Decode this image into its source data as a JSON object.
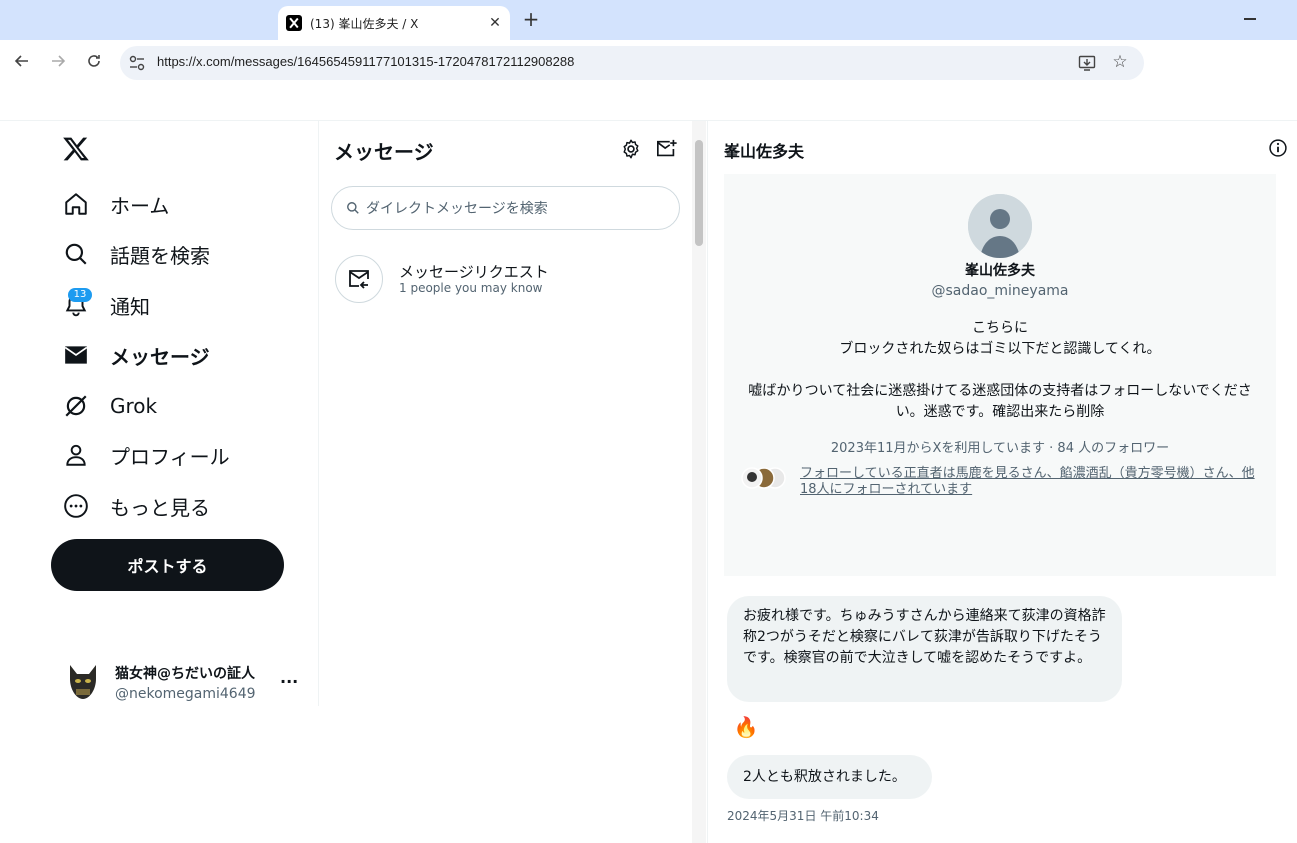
{
  "browser": {
    "tab_title": "(13) 峯山佐多夫 / X",
    "tab_close": "✕",
    "new_tab": "+",
    "url": "https://x.com/messages/1645654591177101315-1720478172112908288"
  },
  "nav": {
    "items": [
      {
        "label": "ホーム",
        "icon": "home-icon"
      },
      {
        "label": "話題を検索",
        "icon": "search-icon"
      },
      {
        "label": "通知",
        "icon": "bell-icon"
      },
      {
        "label": "メッセージ",
        "icon": "envelope-icon"
      },
      {
        "label": "Grok",
        "icon": "grok-icon"
      },
      {
        "label": "プロフィール",
        "icon": "person-icon"
      },
      {
        "label": "もっと見る",
        "icon": "more-circle-icon"
      }
    ],
    "notification_count": "13",
    "post_button": "ポストする"
  },
  "account": {
    "name": "猫女神@ちだいの証人",
    "handle": "@nekomegami4649",
    "more": "···"
  },
  "messages": {
    "heading": "メッセージ",
    "search_placeholder": "ダイレクトメッセージを検索",
    "request_title": "メッセージリクエスト",
    "request_sub": "1 people you may know"
  },
  "conversation": {
    "title": "峯山佐多夫",
    "profile": {
      "name": "峯山佐多夫",
      "handle": "@sadao_mineyama",
      "bio": "こちらに\nブロックされた奴らはゴミ以下だと認識してくれ。\n\n嘘ばかりついて社会に迷惑掛けてる迷惑団体の支持者はフォローしないでください。迷惑です。確認出来たら削除",
      "meta": "2023年11月からXを利用しています · 84 人のフォロワー",
      "followed_by": "フォローしている正直者は馬鹿を見るさん、餡濃酒乱（貴方零号機）さん、他18人にフォローされています"
    },
    "messages": [
      {
        "text": "お疲れ様です。ちゅみうすさんから連絡来て荻津の資格詐称2つがうそだと検察にバレて荻津が告訴取り下げたそうです。検察官の前で大泣きして嘘を認めたそうですよ。"
      },
      {
        "reaction": "🔥"
      },
      {
        "text": "2人とも釈放されました。"
      }
    ],
    "timestamp": "2024年5月31日 午前10:34"
  },
  "colors": {
    "accent": "#1d9bf0",
    "text": "#0f1419",
    "muted": "#536471",
    "bubble": "#eff3f4"
  }
}
